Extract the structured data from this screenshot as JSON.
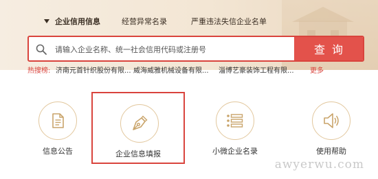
{
  "tabs": [
    {
      "label": "企业信用信息",
      "active": true
    },
    {
      "label": "经营异常名录",
      "active": false
    },
    {
      "label": "严重违法失信企业名单",
      "active": false
    }
  ],
  "search": {
    "placeholder": "请输入企业名称、统一社会信用代码或注册号",
    "button_label": "查询"
  },
  "hot": {
    "label": "热搜榜:",
    "items": [
      "济南元首针织股份有限...",
      "威海威雅机械设备有限...",
      "淄博艺豪装饰工程有限..."
    ],
    "more_label": "更多"
  },
  "services": [
    {
      "label": "信息公告",
      "icon": "document-icon",
      "highlighted": false
    },
    {
      "label": "企业信息填报",
      "icon": "pen-nib-icon",
      "highlighted": true
    },
    {
      "label": "小微企业名录",
      "icon": "list-icon",
      "highlighted": false
    },
    {
      "label": "使用帮助",
      "icon": "speaker-icon",
      "highlighted": false
    }
  ],
  "watermark": "awyerwu.com",
  "colors": {
    "accent": "#d9433c",
    "button": "#e3524b",
    "icon": "#c9a46a",
    "header_bg": "#f3e6d4"
  }
}
